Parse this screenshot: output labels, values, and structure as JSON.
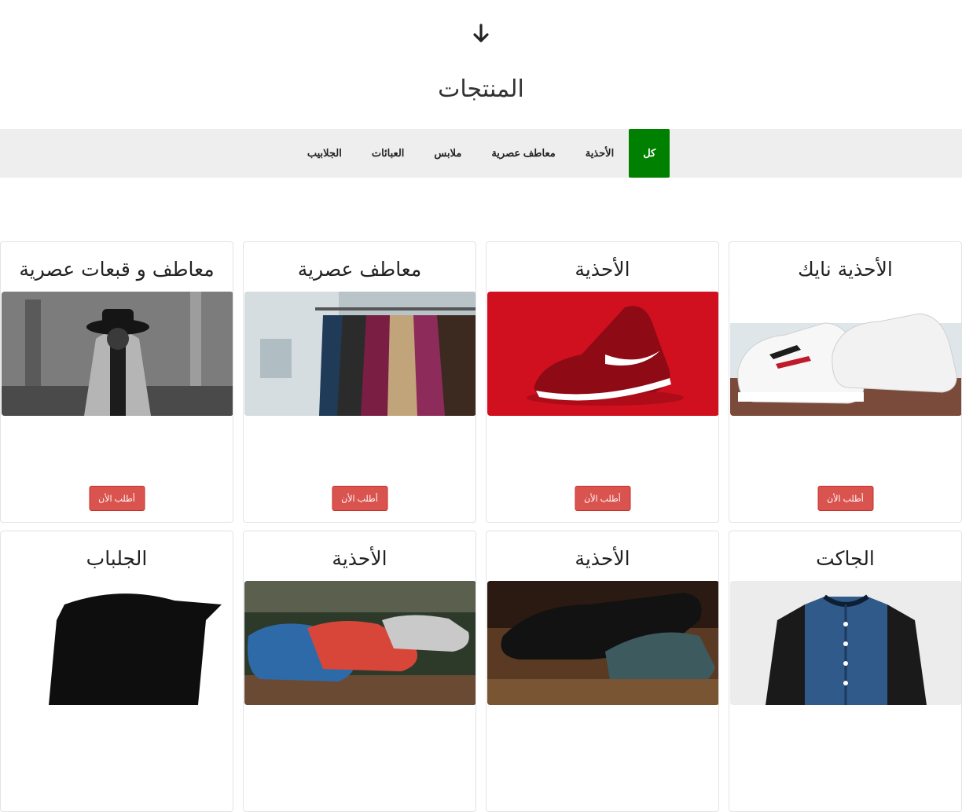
{
  "header": {
    "scroll_icon": "arrow-down-icon",
    "title": "المنتجات"
  },
  "filters": [
    {
      "label": "كل",
      "active": true
    },
    {
      "label": "الأحذية"
    },
    {
      "label": "معاطف عصرية"
    },
    {
      "label": "ملابس"
    },
    {
      "label": "العبائات"
    },
    {
      "label": "الجلابيب"
    }
  ],
  "colors": {
    "active_filter": "#008000",
    "order_button": "#d9534f",
    "filter_bar": "#eeeeee"
  },
  "products": [
    {
      "title": "معاطف و قبعات عصرية",
      "image": "man-coat-hat-photo",
      "button": "أطلب الأن"
    },
    {
      "title": "معاطف عصرية",
      "image": "clothes-rack-photo",
      "button": "أطلب الأن"
    },
    {
      "title": "الأحذية",
      "image": "red-sneaker-photo",
      "button": "أطلب الأن"
    },
    {
      "title": "الأحذية نايك",
      "image": "white-sneakers-photo",
      "button": "أطلب الأن"
    },
    {
      "title": "الجلباب",
      "image": "black-jilbab-photo"
    },
    {
      "title": "الأحذية",
      "image": "loafers-photo"
    },
    {
      "title": "الأحذية",
      "image": "leather-shoes-photo"
    },
    {
      "title": "الجاكت",
      "image": "varsity-jacket-photo"
    }
  ]
}
